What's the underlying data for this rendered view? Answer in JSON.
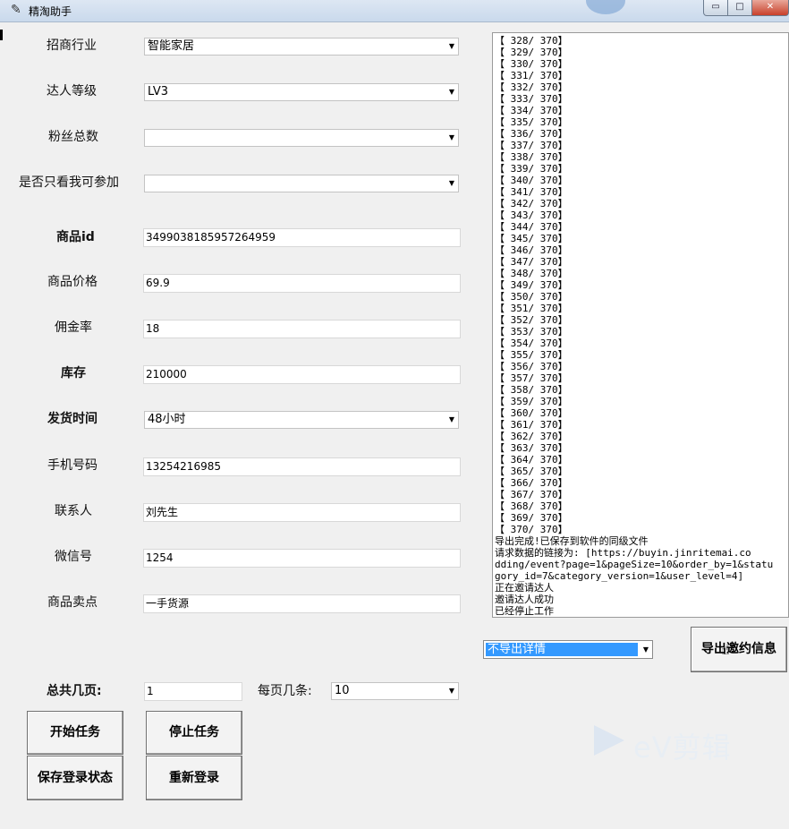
{
  "window": {
    "title": "精淘助手",
    "app_icon": "feather-icon",
    "minimize_glyph": "▭",
    "maximize_glyph": "□",
    "close_glyph": "✕"
  },
  "form": {
    "industry": {
      "label": "招商行业",
      "value": "智能家居"
    },
    "talent_level": {
      "label": "达人等级",
      "value": "LV3"
    },
    "fans_count": {
      "label": "粉丝总数",
      "value": ""
    },
    "only_me": {
      "label": "是否只看我可参加",
      "value": ""
    },
    "product_id": {
      "label": "商品id",
      "value": "3499038185957264959"
    },
    "product_price": {
      "label": "商品价格",
      "value": "69.9"
    },
    "commission_rate": {
      "label": "佣金率",
      "value": "18"
    },
    "stock": {
      "label": "库存",
      "value": "210000"
    },
    "ship_time": {
      "label": "发货时间",
      "value": "48小时"
    },
    "phone": {
      "label": "手机号码",
      "value": "13254216985"
    },
    "contact": {
      "label": "联系人",
      "value": "刘先生"
    },
    "wechat": {
      "label": "微信号",
      "value": "1254"
    },
    "selling_point": {
      "label": "商品卖点",
      "value": "一手货源"
    },
    "total_pages": {
      "label": "总共几页:",
      "value": "1"
    },
    "per_page": {
      "label": "每页几条:",
      "value": "10"
    }
  },
  "buttons": {
    "start": "开始任务",
    "stop": "停止任务",
    "save_login": "保存登录状态",
    "relogin": "重新登录",
    "export": "导出邀约信息"
  },
  "export_mode": {
    "value": "不导出详情"
  },
  "log": {
    "lines": [
      "【 328/ 370】",
      "【 329/ 370】",
      "【 330/ 370】",
      "【 331/ 370】",
      "【 332/ 370】",
      "【 333/ 370】",
      "【 334/ 370】",
      "【 335/ 370】",
      "【 336/ 370】",
      "【 337/ 370】",
      "【 338/ 370】",
      "【 339/ 370】",
      "【 340/ 370】",
      "【 341/ 370】",
      "【 342/ 370】",
      "【 343/ 370】",
      "【 344/ 370】",
      "【 345/ 370】",
      "【 346/ 370】",
      "【 347/ 370】",
      "【 348/ 370】",
      "【 349/ 370】",
      "【 350/ 370】",
      "【 351/ 370】",
      "【 352/ 370】",
      "【 353/ 370】",
      "【 354/ 370】",
      "【 355/ 370】",
      "【 356/ 370】",
      "【 357/ 370】",
      "【 358/ 370】",
      "【 359/ 370】",
      "【 360/ 370】",
      "【 361/ 370】",
      "【 362/ 370】",
      "【 363/ 370】",
      "【 364/ 370】",
      "【 365/ 370】",
      "【 366/ 370】",
      "【 367/ 370】",
      "【 368/ 370】",
      "【 369/ 370】",
      "【 370/ 370】",
      "导出完成!已保存到软件的同级文件",
      "请求数据的链接为: [https://buyin.jinritemai.co",
      "dding/event?page=1&pageSize=10&order_by=1&statu",
      "gory_id=7&category_version=1&user_level=4]",
      "正在邀请达人",
      "邀请达人成功",
      "已经停止工作"
    ]
  },
  "watermark": {
    "text": "eV剪辑"
  },
  "icons": {
    "dropdown": "▼",
    "cursor": "pointer-cursor-icon"
  }
}
